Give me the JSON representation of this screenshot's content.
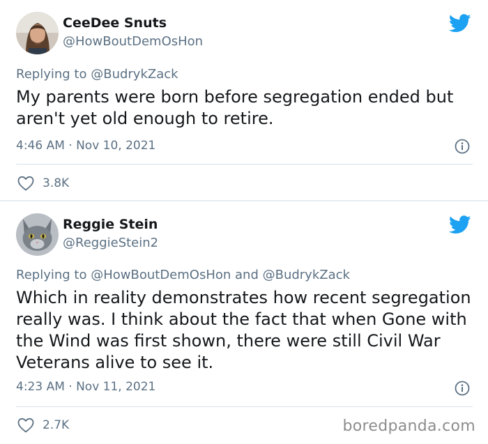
{
  "tweets": [
    {
      "display_name": "CeeDee Snuts",
      "handle": "@HowBoutDemOsHon",
      "replying_prefix": "Replying to",
      "replying_to": "@BudrykZack",
      "text": "My parents were born before segregation ended but aren't yet old enough to retire.",
      "timestamp": "4:46 AM · Nov 10, 2021",
      "likes": "3.8K",
      "avatar": "man-with-long-hair-avatar"
    },
    {
      "display_name": "Reggie Stein",
      "handle": "@ReggieStein2",
      "replying_prefix": "Replying to",
      "replying_to": "@HowBoutDemOsHon and @BudrykZack",
      "text": "Which in reality demonstrates how recent segregation really was. I think about the fact that when Gone with the Wind was first shown, there were still Civil War Veterans alive to see it.",
      "timestamp": "4:23 AM · Nov 11, 2021",
      "likes": "2.7K",
      "avatar": "gray-cat-avatar"
    }
  ],
  "watermark": "boredpanda.com",
  "icons": {
    "brand": "twitter-bird-icon",
    "info": "info-icon",
    "like": "heart-icon"
  },
  "colors": {
    "twitter_blue": "#1da1f2",
    "secondary_text": "#5b7083",
    "primary_text": "#14171a"
  }
}
